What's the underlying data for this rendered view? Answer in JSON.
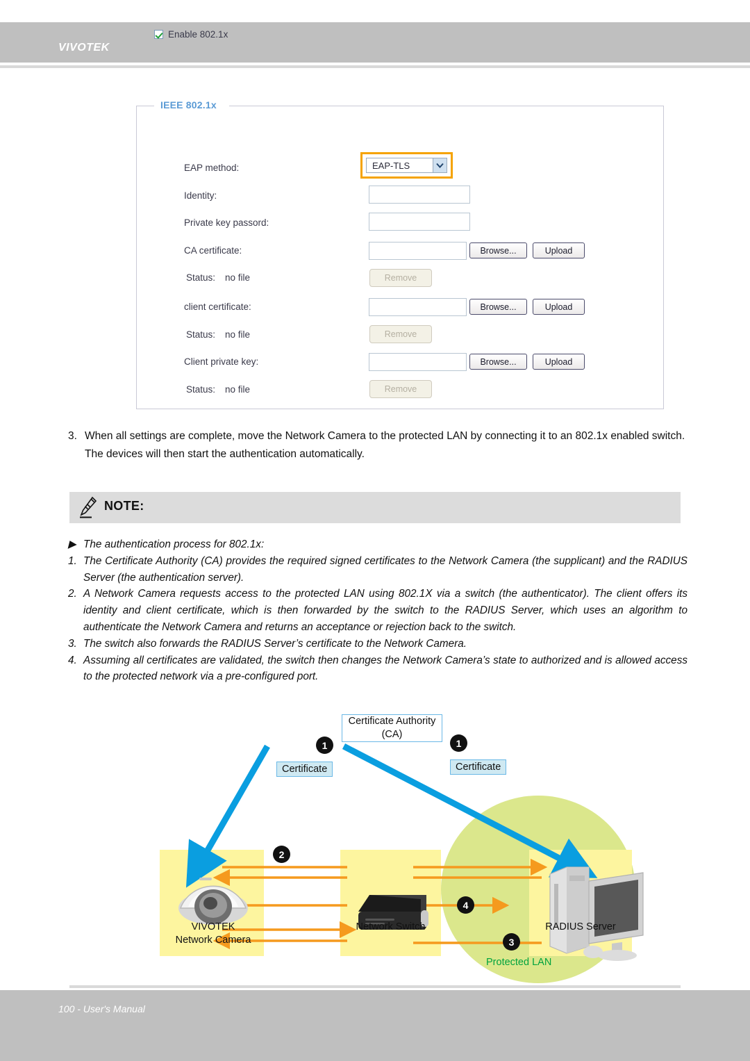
{
  "header": {
    "brand": "VIVOTEK"
  },
  "panel": {
    "legend": "IEEE 802.1x",
    "enable_checkbox_label": "Enable 802.1x",
    "fields": {
      "eap_method_label": "EAP method:",
      "eap_method_value": "EAP-TLS",
      "identity_label": "Identity:",
      "identity_value": "",
      "private_key_password_label": "Private key passord:",
      "private_key_password_value": "",
      "ca_certificate_label": "CA certificate:",
      "ca_certificate_value": "",
      "ca_status_label": "Status:",
      "ca_status_value": "no file",
      "client_certificate_label": "client certificate:",
      "client_certificate_value": "",
      "client_status_label": "Status:",
      "client_status_value": "no file",
      "client_private_key_label": "Client private key:",
      "client_private_key_value": "",
      "key_status_label": "Status:",
      "key_status_value": "no file"
    },
    "buttons": {
      "browse": "Browse...",
      "upload": "Upload",
      "remove": "Remove"
    },
    "accent_highlight": "#f5a300"
  },
  "step3": {
    "number": "3.",
    "text": "When all settings are complete, move the Network Camera to the protected LAN by connecting it to an 802.1x enabled switch. The devices will then start the authentication automatically."
  },
  "note": {
    "title": "NOTE:",
    "intro_marker": "▶",
    "intro": "The authentication process for 802.1x:",
    "items": [
      {
        "marker": "1.",
        "text": "The Certificate Authority (CA) provides the required signed certificates to the Network Camera (the supplicant) and the RADIUS Server (the authentication server)."
      },
      {
        "marker": "2.",
        "text": "A Network Camera requests access to the protected LAN using 802.1X via a switch (the authenticator). The client offers its identity and client certificate, which is then forwarded by the switch to the RADIUS Server, which uses an algorithm to authenticate the Network Camera and returns an acceptance or rejection back to the switch."
      },
      {
        "marker": "3.",
        "text": "The switch also forwards the RADIUS Server’s certificate to the Network Camera."
      },
      {
        "marker": "4.",
        "text": "Assuming all certificates are validated, the switch then changes the Network Camera’s state to authorized and is allowed access to the protected network via a pre-configured port."
      }
    ]
  },
  "diagram": {
    "ca_line1": "Certificate Authority",
    "ca_line2": "(CA)",
    "certificate_left": "Certificate",
    "certificate_right": "Certificate",
    "camera_line1": "VIVOTEK",
    "camera_line2": "Network Camera",
    "switch_label": "Network Switch",
    "radius_label": "RADIUS Server",
    "protected_lan": "Protected LAN",
    "badges": [
      "1",
      "1",
      "2",
      "4",
      "3"
    ],
    "colors": {
      "cert_arrow": "#0a9ee0",
      "data_arrow": "#f59a1e",
      "lan_ellipse": "#dbe78c",
      "device_box": "#fdf59f",
      "cert_box": "#cfe9f2",
      "lan_text": "#00a33e"
    }
  },
  "footer": {
    "page_text": "100 - User's Manual"
  }
}
